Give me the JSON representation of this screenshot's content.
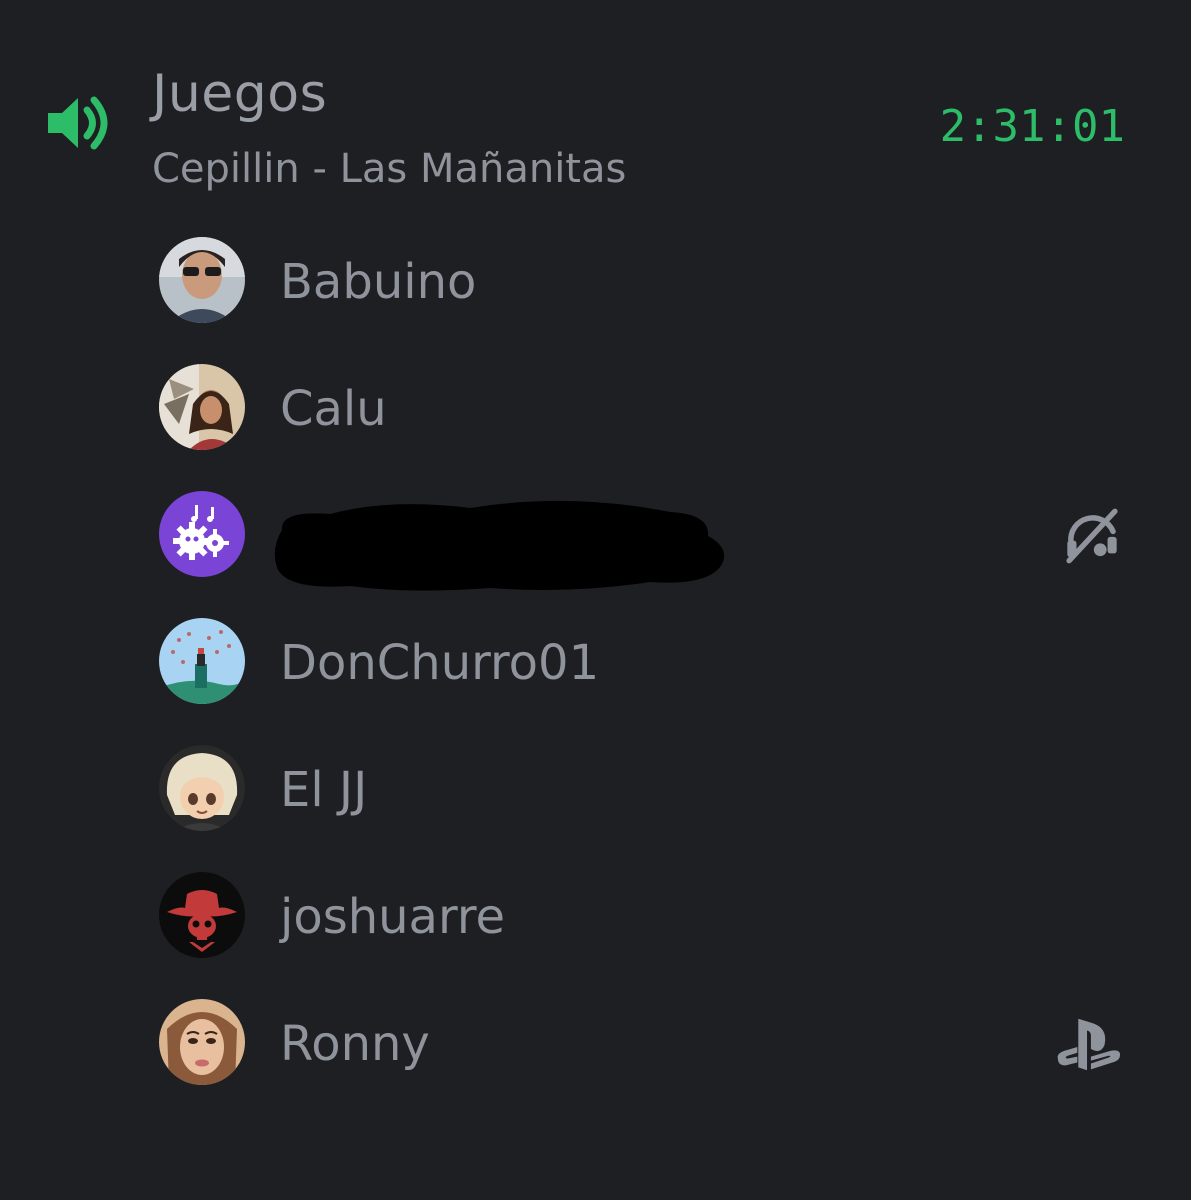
{
  "channel": {
    "name": "Juegos",
    "status": "Cepillin - Las Mañanitas",
    "timer": "2:31:01",
    "speaker_icon": "speaker-icon",
    "accent_color": "#2dbc67"
  },
  "members": [
    {
      "name": "Babuino",
      "avatar": "photo-avatar"
    },
    {
      "name": "Calu",
      "avatar": "photo-avatar"
    },
    {
      "name": "",
      "avatar": "music-bot-avatar",
      "name_redacted": true,
      "status_icon": "music-off-icon"
    },
    {
      "name": "DonChurro01",
      "avatar": "landscape-avatar"
    },
    {
      "name": "El JJ",
      "avatar": "anime-avatar"
    },
    {
      "name": "joshuarre",
      "avatar": "cowboy-skull-avatar"
    },
    {
      "name": "Ronny",
      "avatar": "photo-avatar",
      "status_icon": "playstation-icon"
    }
  ]
}
